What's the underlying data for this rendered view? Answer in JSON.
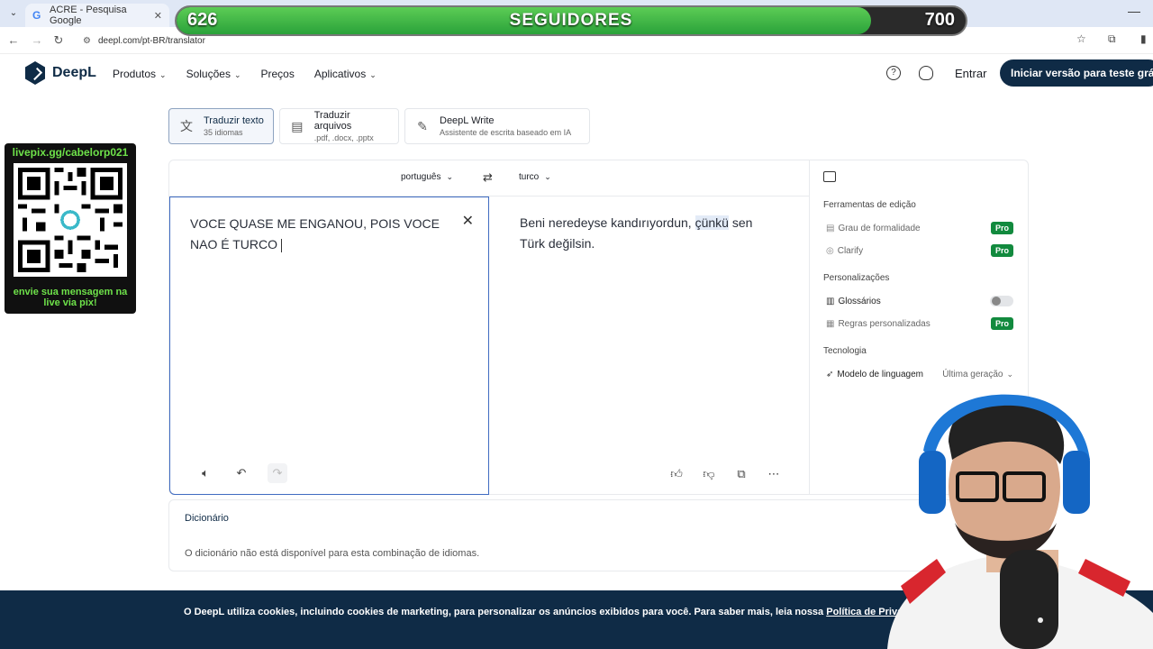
{
  "browser": {
    "tab_title": "ACRE - Pesquisa Google",
    "url": "deepl.com/pt-BR/translator"
  },
  "overlay": {
    "followers_current": "626",
    "followers_label": "SEGUIDORES",
    "followers_goal": "700",
    "followers_progress": 0.88,
    "qr_url": "livepix.gg/cabelorp021",
    "qr_message": "envie sua mensagem na live via pix!"
  },
  "header": {
    "logo": "DeepL",
    "nav": [
      {
        "label": "Produtos",
        "dropdown": true
      },
      {
        "label": "Soluções",
        "dropdown": true
      },
      {
        "label": "Preços",
        "dropdown": false
      },
      {
        "label": "Aplicativos",
        "dropdown": true
      }
    ],
    "login": "Entrar",
    "trial_button": "Iniciar versão para teste grátis"
  },
  "modes": [
    {
      "title": "Traduzir texto",
      "subtitle": "35 idiomas",
      "icon": "translate-icon",
      "active": true
    },
    {
      "title": "Traduzir arquivos",
      "subtitle": ".pdf, .docx, .pptx",
      "icon": "file-icon",
      "active": false
    },
    {
      "title": "DeepL Write",
      "subtitle": "Assistente de escrita baseado em IA",
      "icon": "magic-pen-icon",
      "active": false
    }
  ],
  "translator": {
    "source_lang": "português",
    "target_lang": "turco",
    "source_text_line1": "VOCE QUASE ME ENGANOU, POIS VOCE",
    "source_text_line2": "NAO É TURCO",
    "target_before": "Beni neredeyse kandırıyordun, ",
    "target_highlight": "çünkü",
    "target_after": " sen",
    "target_line2": "Türk değilsin."
  },
  "side_panel": {
    "section_editing": "Ferramentas de edição",
    "formality": "Grau de formalidade",
    "clarify": "Clarify",
    "section_custom": "Personalizações",
    "glossaries": "Glossários",
    "custom_rules": "Regras personalizadas",
    "section_tech": "Tecnologia",
    "model_label": "Modelo de linguagem",
    "model_value": "Última geração",
    "pro_badge": "Pro"
  },
  "dictionary": {
    "title": "Dicionário",
    "message": "O dicionário não está disponível para esta combinação de idiomas."
  },
  "cookie": {
    "text": "O DeepL utiliza cookies, incluindo cookies de marketing, para personalizar os anúncios exibidos para você. Para saber mais, leia nossa ",
    "link": "Política de Privacidade"
  },
  "colors": {
    "brand": "#0f2b46",
    "pro_green": "#128a3e",
    "follower_bar": "#3ab849",
    "qr_text": "#6ee24a"
  }
}
